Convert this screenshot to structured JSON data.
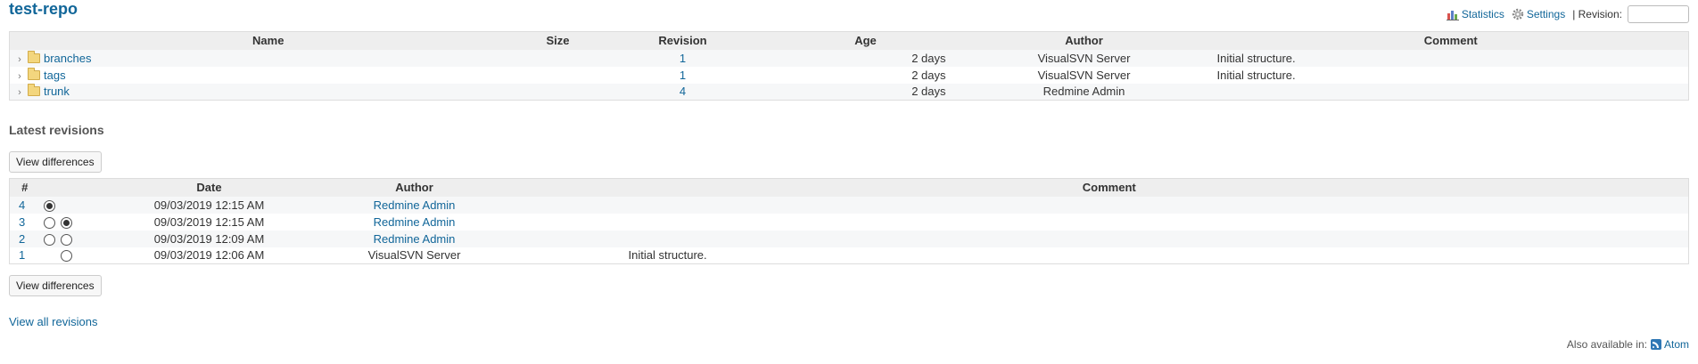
{
  "repository": {
    "title": "test-repo"
  },
  "contextual": {
    "statistics_label": "Statistics",
    "settings_label": "Settings",
    "revision_label": "| Revision:",
    "revision_value": ""
  },
  "entries": {
    "columns": [
      "Name",
      "Size",
      "Revision",
      "Age",
      "Author",
      "Comment"
    ],
    "rows": [
      {
        "name": "branches",
        "size": "",
        "revision": "1",
        "age": "2 days",
        "author": "VisualSVN Server",
        "comment": "Initial structure."
      },
      {
        "name": "tags",
        "size": "",
        "revision": "1",
        "age": "2 days",
        "author": "VisualSVN Server",
        "comment": "Initial structure."
      },
      {
        "name": "trunk",
        "size": "",
        "revision": "4",
        "age": "2 days",
        "author": "Redmine Admin",
        "comment": ""
      }
    ]
  },
  "latest_revisions": {
    "title": "Latest revisions",
    "view_differences_label": "View differences",
    "columns": [
      "#",
      "",
      "",
      "Date",
      "Author",
      "Comment"
    ],
    "rows": [
      {
        "id": "4",
        "date": "09/03/2019 12:15 AM",
        "author": "Redmine Admin",
        "comment": ""
      },
      {
        "id": "3",
        "date": "09/03/2019 12:15 AM",
        "author": "Redmine Admin",
        "comment": ""
      },
      {
        "id": "2",
        "date": "09/03/2019 12:09 AM",
        "author": "Redmine Admin",
        "comment": ""
      },
      {
        "id": "1",
        "date": "09/03/2019 12:06 AM",
        "author": "VisualSVN Server",
        "comment": "Initial structure."
      }
    ],
    "view_all_label": "View all revisions"
  },
  "other_formats": {
    "label": "Also available in:",
    "atom_label": "Atom"
  },
  "colors": {
    "link": "#116699",
    "header_bg": "#eeeeee",
    "odd_row_bg": "#f6f7f8"
  }
}
